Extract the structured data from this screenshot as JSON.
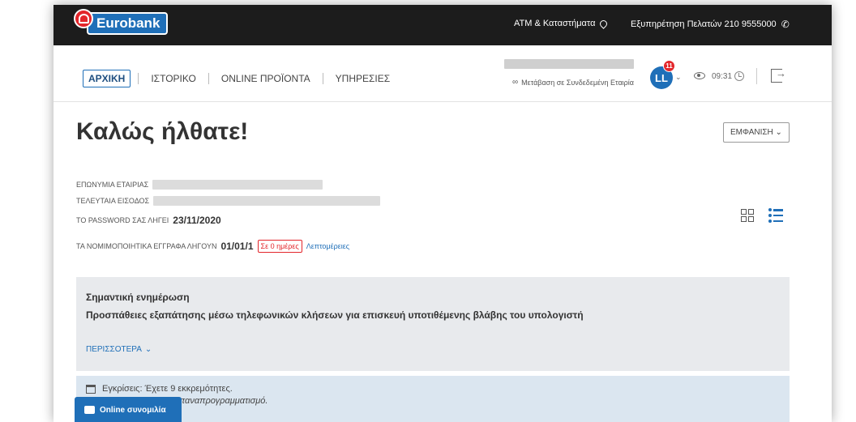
{
  "brand": {
    "name": "Eurobank"
  },
  "topbar": {
    "atm_label": "ATM & Καταστήματα",
    "support_label": "Εξυπηρέτηση Πελατών 210 9555000"
  },
  "nav": {
    "tabs": [
      {
        "label": "ΑΡΧΙΚΗ",
        "active": true
      },
      {
        "label": "ΙΣΤΟΡΙΚΟ"
      },
      {
        "label": "ONLINE ΠΡΟΪΟΝΤΑ"
      },
      {
        "label": "ΥΠΗΡΕΣΙΕΣ"
      }
    ],
    "company_switch_label": "Μετάβαση σε Συνδεδεμένη Εταιρία",
    "avatar_initials": "LL",
    "notification_count": "11",
    "session_time": "09:31"
  },
  "main": {
    "welcome": "Καλώς ήλθατε!",
    "view_button": "ΕΜΦΑΝΙΣΗ",
    "company_name_label": "ΕΠΩΝΥΜΙΑ ΕΤΑΙΡΙΑΣ",
    "last_login_label": "ΤΕΛΕΥΤΑΙΑ ΕΙΣΟΔΟΣ",
    "password_label": "ΤΟ PASSWORD ΣΑΣ ΛΗΓΕΙ",
    "password_expiry": "23/11/2020",
    "docs_label": "ΤΑ ΝΟΜΙΜΟΠΟΙΗΤΙΚΑ ΕΓΓΡΑΦΑ ΛΗΓΟΥΝ",
    "docs_expiry": "01/01/1",
    "docs_days_badge": "Σε 0 ημέρες",
    "details_link": "Λεπτομέρειες"
  },
  "notice": {
    "title": "Σημαντική ενημέρωση",
    "text": "Προσπάθειες εξαπάτησης μέσω τηλεφωνικών κλήσεων για επισκευή υποτιθέμενης βλάβης του υπολογιστή",
    "more_label": "ΠΕΡΙΣΣΟΤΕΡΑ"
  },
  "pending": {
    "line1": "Εγκρίσεις: Έχετε 9 εκκρεμότητες.",
    "line2": "επαναπρογραμματισμό."
  },
  "chat": {
    "label": "Online συνομιλία"
  }
}
